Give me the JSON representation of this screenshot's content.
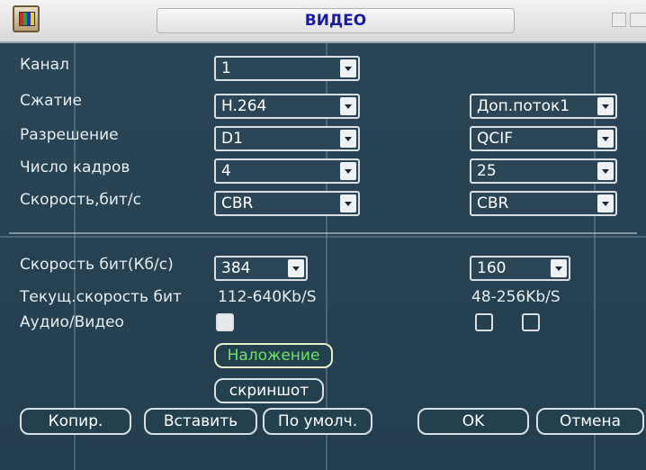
{
  "window": {
    "title": "ВИДЕО",
    "icon": "video-settings-icon"
  },
  "colors": {
    "title_text": "#1a1aa8",
    "background": "#2a4657",
    "overlay_active_text": "#6fe06a"
  },
  "main": {
    "channel": {
      "label": "Канал",
      "value": "1"
    },
    "compression": {
      "label": "Сжатие",
      "main_value": "H.264",
      "extra_value": "Доп.поток1"
    },
    "resolution": {
      "label": "Разрешение",
      "main_value": "D1",
      "extra_value": "QCIF"
    },
    "frame_rate": {
      "label": "Число кадров",
      "main_value": "4",
      "extra_value": "25"
    },
    "bitrate_type": {
      "label": "Скорость,бит/с",
      "main_value": "CBR",
      "extra_value": "CBR"
    },
    "bitrate": {
      "label": "Скорость бит(Кб/с)",
      "main_value": "384",
      "extra_value": "160"
    },
    "current_bitrate": {
      "label": "Текущ.скорость бит",
      "main_value": "112-640Kb/S",
      "extra_value": "48-256Kb/S"
    },
    "audio_video": {
      "label": "Аудио/Видео",
      "main_checked": true,
      "extra_checked": false,
      "extra2_checked": false
    },
    "overlay_button": "Наложение",
    "snapshot_button": "скриншот"
  },
  "footer": {
    "copy": "Копир.",
    "paste": "Вставить",
    "default": "По умолч.",
    "ok": "OK",
    "cancel": "Отмена"
  }
}
